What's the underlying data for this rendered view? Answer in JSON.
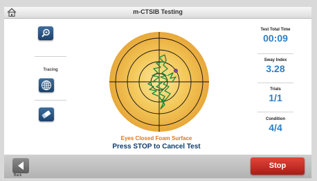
{
  "window": {
    "title": "m-CTSIB Testing"
  },
  "left_panel": {
    "tracing_label": "Tracing"
  },
  "main": {
    "condition_text": "Eyes Closed Foam Surface",
    "instruction_text": "Press STOP to Cancel Test"
  },
  "stats": {
    "total_time": {
      "label": "Test Total Time",
      "value": "00:09"
    },
    "sway_index": {
      "label": "Sway Index",
      "value": "3.28"
    },
    "trials": {
      "label": "Trials",
      "value": "1/1"
    },
    "condition": {
      "label": "Condition",
      "value": "4/4"
    }
  },
  "bottom": {
    "back_label": "Back",
    "stop_label": "Stop"
  },
  "colors": {
    "accent": "#2f7fc4",
    "stop": "#c62b22",
    "target_center": "#f3d36b",
    "target_edge": "#e8a83a",
    "trace": "#1f8a3a"
  },
  "icons": [
    "home-icon",
    "zoom-icon",
    "globe-icon",
    "eraser-icon",
    "back-arrow-icon"
  ]
}
